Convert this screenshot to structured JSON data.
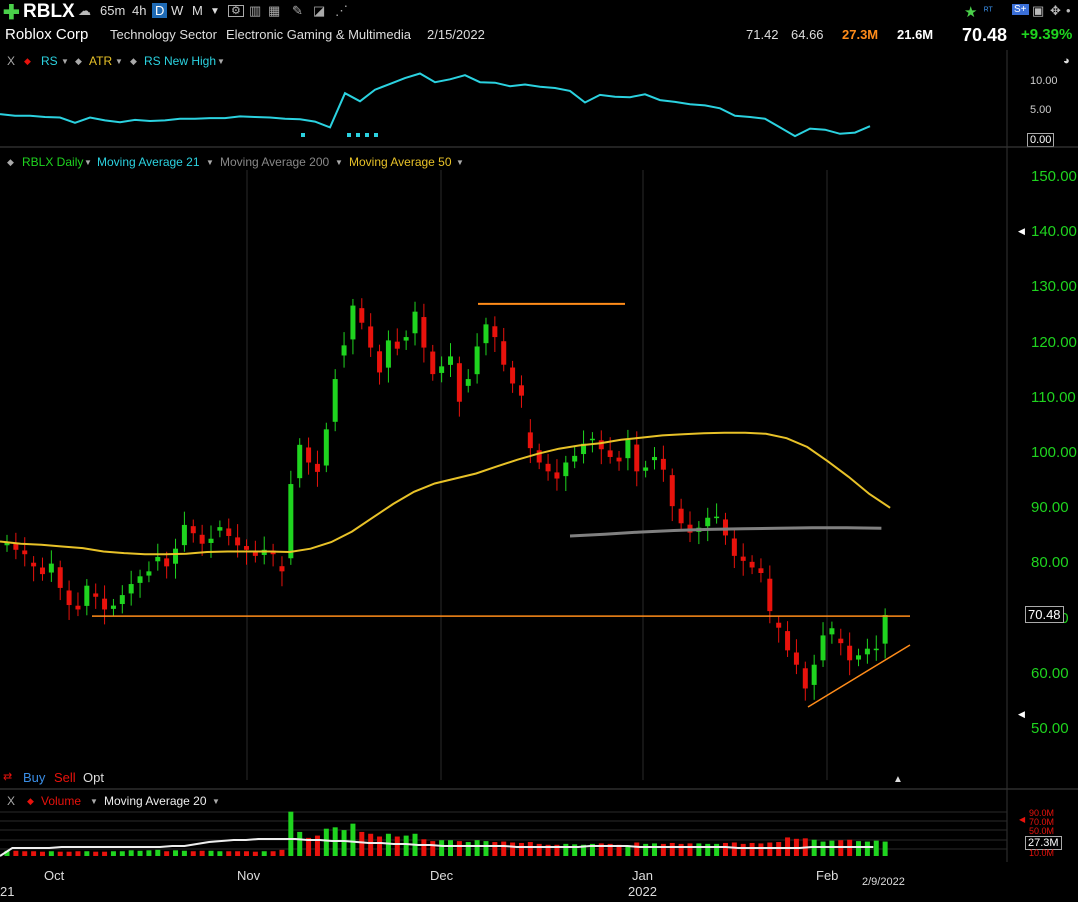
{
  "toolbar": {
    "symbol": "RBLX",
    "timeframes": [
      "65m",
      "4h",
      "D",
      "W",
      "M"
    ],
    "active_timeframe": "D"
  },
  "info": {
    "company": "Roblox Corp",
    "sector": "Technology Sector",
    "industry": "Electronic Gaming & Multimedia",
    "date": "2/15/2022",
    "high": "71.42",
    "low": "64.66",
    "volume": "27.3M",
    "avg_volume": "21.6M",
    "price": "70.48",
    "change": "+9.39%"
  },
  "rs_pane": {
    "close": "X",
    "items": [
      "RS",
      "ATR",
      "RS New High"
    ],
    "ticks": [
      "10.00",
      "5.00",
      "0.00"
    ]
  },
  "price_pane": {
    "items": [
      "RBLX Daily",
      "Moving Average 21",
      "Moving Average 200",
      "Moving Average 50"
    ],
    "ticks": [
      "150.00",
      "140.00",
      "130.00",
      "120.00",
      "110.00",
      "100.00",
      "90.00",
      "80.00",
      "70.00",
      "60.00",
      "50.00"
    ],
    "price_label": "70.48",
    "orders": {
      "buy": "Buy",
      "sell": "Sell",
      "opt": "Opt"
    }
  },
  "volume_pane": {
    "close": "X",
    "items": [
      "Volume",
      "Moving Average 20"
    ],
    "ticks": [
      "90.0M",
      "70.0M",
      "50.0M",
      "27.3M",
      "10.0M"
    ]
  },
  "xaxis": {
    "months": [
      "Oct",
      "Nov",
      "Dec",
      "Jan",
      "Feb"
    ],
    "year": "2022",
    "left_year": "21",
    "cursor_date": "2/9/2022"
  },
  "colors": {
    "up": "#1fd41f",
    "down": "#e8120c",
    "ma50": "#e8c228",
    "ma200": "#808080",
    "rs": "#2bd2e0",
    "trend": "#ff8c1a"
  },
  "chart_data": {
    "type": "candlestick",
    "closes": [
      83.8,
      82.3,
      81.5,
      79.3,
      77.9,
      79.8,
      75.4,
      72.3,
      71.5,
      75.8,
      73.8,
      71.5,
      72.2,
      74.1,
      76.1,
      77.5,
      78.4,
      81.0,
      79.3,
      82.5,
      86.8,
      85.3,
      83.4,
      84.3,
      86.4,
      84.8,
      83.1,
      82.3,
      81.2,
      82.3,
      81.5,
      78.4,
      94.2,
      101.3,
      98.1,
      96.4,
      104.1,
      113.2,
      119.3,
      126.5,
      123.4,
      118.9,
      114.4,
      120.2,
      118.7,
      120.8,
      125.4,
      118.9,
      114.1,
      115.5,
      117.3,
      109.1,
      113.2,
      119.1,
      123.1,
      120.8,
      115.8,
      112.4,
      110.2,
      100.7,
      98.1,
      96.5,
      95.2,
      98.1,
      99.3,
      101.5,
      102.4,
      100.5,
      99.1,
      98.3,
      102.2,
      96.5,
      97.2,
      99.1,
      96.8,
      90.2,
      87.1,
      85.4,
      86.3,
      88.1,
      88.3,
      84.9,
      81.2,
      80.3,
      79.1,
      78.1,
      71.2,
      68.2,
      64.1,
      61.5,
      57.2,
      61.5,
      66.8,
      68.1,
      65.4,
      62.3,
      63.2,
      64.4,
      64.4,
      70.5
    ],
    "ma50": [
      83.8,
      83.4,
      83.2,
      82.9,
      82.6,
      82.0,
      81.7,
      81.5,
      81.5,
      81.6,
      81.9,
      82.0,
      82.0,
      82.0,
      81.9,
      82.5,
      83.7,
      85.6,
      88.1,
      90.6,
      92.8,
      94.3,
      95.2,
      96.1,
      97.4,
      98.6,
      99.7,
      100.6,
      101.2,
      101.6,
      102.2,
      102.6,
      103.0,
      103.2,
      103.4,
      103.5,
      103.5,
      103.3,
      102.5,
      100.9,
      98.3,
      95.5,
      92.4,
      89.9
    ],
    "ma200": [
      84.8,
      85.1,
      85.5,
      85.8,
      86.0,
      86.1,
      86.2,
      86.3,
      86.3,
      86.2
    ],
    "rs": [
      4.3,
      4.0,
      4.0,
      3.8,
      3.7,
      2.8,
      3.7,
      3.2,
      2.9,
      3.3,
      3.1,
      3.2,
      3.5,
      3.5,
      3.6,
      3.6,
      3.9,
      3.8,
      3.7,
      3.5,
      3.4,
      3.0,
      2.0,
      7.9,
      6.5,
      8.5,
      9.5,
      10.5,
      11.3,
      9.8,
      10.3,
      11.0,
      9.8,
      9.7,
      9.1,
      9.4,
      9.0,
      8.8,
      8.3,
      6.3,
      7.6,
      7.3,
      7.2,
      7.7,
      6.7,
      6.4,
      6.0,
      5.8,
      5.3,
      4.0,
      3.8,
      3.5,
      2.0,
      0.5,
      1.8,
      1.6,
      0.9,
      1.1,
      2.2
    ],
    "volume": [
      7,
      7,
      6,
      6,
      5,
      6,
      5,
      5,
      6,
      6,
      5,
      5,
      6,
      6,
      8,
      7,
      8,
      9,
      6,
      8,
      7,
      6,
      7,
      7,
      6,
      6,
      6,
      6,
      5,
      6,
      6,
      9,
      92,
      48,
      35,
      40,
      55,
      58,
      52,
      66,
      48,
      44,
      38,
      44,
      38,
      40,
      44,
      32,
      28,
      30,
      30,
      28,
      26,
      30,
      28,
      26,
      27,
      25,
      24,
      26,
      22,
      20,
      20,
      22,
      21,
      20,
      22,
      23,
      22,
      20,
      19,
      25,
      22,
      23,
      22,
      24,
      22,
      23,
      23,
      22,
      22,
      24,
      25,
      22,
      24,
      23,
      25,
      26,
      36,
      33,
      34,
      31,
      27,
      29,
      30,
      31,
      28,
      27,
      29,
      27
    ],
    "levels": [
      {
        "price": 70.3,
        "type": "support"
      },
      {
        "price": 126.8,
        "type": "resistance"
      }
    ],
    "ylim": [
      45,
      155
    ]
  }
}
